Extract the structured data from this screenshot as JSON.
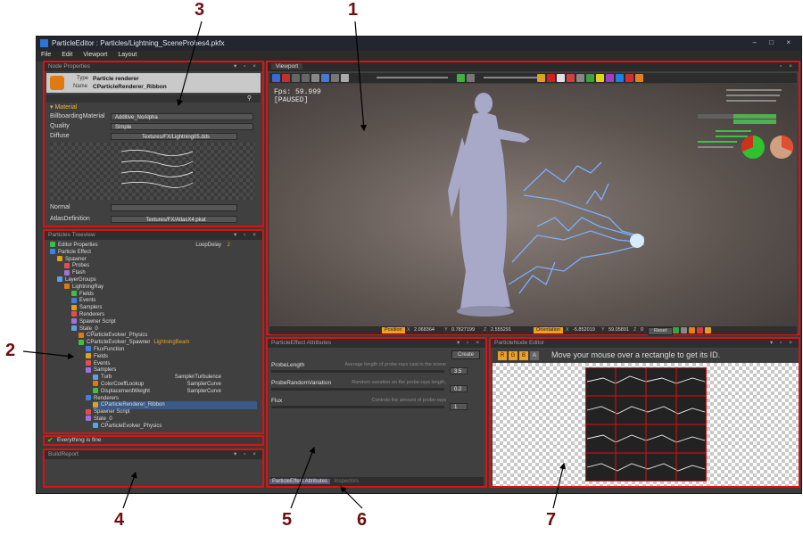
{
  "window": {
    "title": "ParticleEditor : Particles/Lightning_SceneProbes4.pkfx",
    "controls": "– □ ×"
  },
  "menu": [
    "File",
    "Edit",
    "Viewport",
    "Layout"
  ],
  "callouts": [
    "1",
    "2",
    "3",
    "4",
    "5",
    "6",
    "7"
  ],
  "node_properties": {
    "header": "Node Properties",
    "type_label": "Type",
    "type_value": "Particle renderer",
    "name_label": "Name",
    "name_value": "CParticleRenderer_Ribbon",
    "section": "Material",
    "rows": [
      {
        "label": "BillboardingMaterial",
        "value": "Additive_NoAlpha"
      },
      {
        "label": "Quality",
        "value": "Simple"
      },
      {
        "label": "Diffuse",
        "value": "Textures/FX/Lightning05.dds"
      },
      {
        "label": "Normal",
        "value": ""
      },
      {
        "label": "AtlasDefinition",
        "value": "Textures/FX/AtlasX4.pkat"
      }
    ]
  },
  "treeview": {
    "header": "Particles Treeview",
    "items": [
      {
        "label": "Editor Properties",
        "extra": "LoopDelay",
        "value": "2",
        "indent": 0
      },
      {
        "label": "Particle Effect",
        "indent": 0
      },
      {
        "label": "Spawner",
        "indent": 1
      },
      {
        "label": "Probes",
        "indent": 2
      },
      {
        "label": "Flash",
        "indent": 2
      },
      {
        "label": "LayerGroups",
        "indent": 1
      },
      {
        "label": "LightningRay",
        "indent": 2
      },
      {
        "label": "Fields",
        "indent": 3
      },
      {
        "label": "Events",
        "indent": 3
      },
      {
        "label": "Samplers",
        "indent": 3
      },
      {
        "label": "Renderers",
        "indent": 3
      },
      {
        "label": "Spawner Script",
        "indent": 3
      },
      {
        "label": "State_0",
        "indent": 3
      },
      {
        "label": "CParticleEvolver_Physics",
        "indent": 4
      },
      {
        "label": "CParticleEvolver_Spawner",
        "tag": "LightningBeam",
        "indent": 4
      },
      {
        "label": "FluxFunction",
        "indent": 5
      },
      {
        "label": "Fields",
        "indent": 5
      },
      {
        "label": "Events",
        "indent": 5
      },
      {
        "label": "Samplers",
        "indent": 5
      },
      {
        "label": "Turb",
        "extra": "SamplerTurbulence",
        "indent": 6
      },
      {
        "label": "ColorCoeffLookup",
        "extra": "SamplerCurve",
        "indent": 6
      },
      {
        "label": "DisplacementWeight",
        "extra": "SamplerCurve",
        "indent": 6
      },
      {
        "label": "Renderers",
        "indent": 5
      },
      {
        "label": "CParticleRenderer_Ribbon",
        "indent": 6,
        "selected": true
      },
      {
        "label": "Spawner Script",
        "indent": 5
      },
      {
        "label": "State_0",
        "indent": 5
      },
      {
        "label": "CParticleEvolver_Physics",
        "indent": 6
      }
    ]
  },
  "status": {
    "text": "Everything is fine"
  },
  "build_report": {
    "header": "BuildReport"
  },
  "viewport": {
    "tab": "Viewport",
    "fps": "Fps: 59.999",
    "paused": "[PAUSED]",
    "position_label": "Position",
    "pos_x": "2.068364",
    "pos_y": "0.7827199",
    "pos_z": "2.555291",
    "orientation_label": "Orientation",
    "ori_x": "-5.852019",
    "ori_y": "59.05891",
    "ori_z": "0",
    "reset": "Reset",
    "axes": [
      "X",
      "Y",
      "Z",
      "X",
      "Y",
      "Z"
    ]
  },
  "attributes": {
    "header": "ParticleEffect Attributes",
    "create": "Create",
    "rows": [
      {
        "label": "ProbeLength",
        "desc": "Average length of probe-rays cast in the scene",
        "value": "3.5"
      },
      {
        "label": "ProbeRandomVariation",
        "desc": "Random variation on the probe-rays length,",
        "value": "0.2"
      },
      {
        "label": "Flux",
        "desc": "Controls the amount of probe-rays",
        "value": "1"
      }
    ],
    "tabs": [
      "ParticleEffect Attributes",
      "Inspectors"
    ]
  },
  "node_editor": {
    "header": "ParticleNode Editor",
    "buttons": [
      "R",
      "G",
      "B",
      "A"
    ],
    "hint": "Move your mouse over a rectangle to get its ID."
  },
  "colors": {
    "callout_border": "#e01010",
    "orange": "#f0a020",
    "selected": "#3a5a8a"
  }
}
